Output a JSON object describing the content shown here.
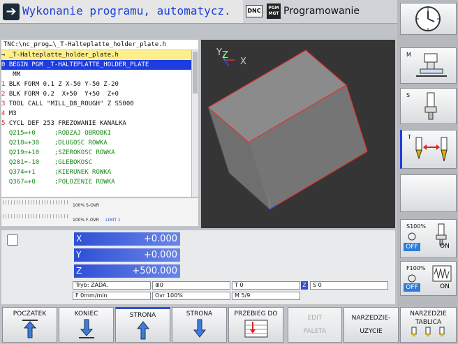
{
  "header": {
    "mode_icon": "arrow-right-icon",
    "mode_title": "Wykonanie programu, automatycz.",
    "dnc_badge": "DNC",
    "pgm_badge_line1": "PGM",
    "pgm_badge_line2": "MGT",
    "prog_title": "Programowanie"
  },
  "program": {
    "path": "TNC:\\nc_prog…\\_T-Halteplatte_holder_plate.h",
    "lines": [
      {
        "n": "",
        "t": "→ _T-Halteplatte_holder_plate.h",
        "style": "file"
      },
      {
        "n": "0",
        "t": "BEGIN PGM _T-HALTEPLATTE_HOLDER_PLATE",
        "style": "sel"
      },
      {
        "n": "",
        "t": "  MM",
        "style": "normal"
      },
      {
        "n": "1",
        "t": "BLK FORM 0.1 Z X-50 Y-50 Z-20",
        "style": "normal"
      },
      {
        "n": "2",
        "t": "BLK FORM 0.2  X+50  Y+50  Z+0",
        "style": "normal"
      },
      {
        "n": "3",
        "t": "TOOL CALL \"MILL_D8_ROUGH\" Z S5000",
        "style": "normal"
      },
      {
        "n": "4",
        "t": "M3",
        "style": "normal"
      },
      {
        "n": "5",
        "t": "CYCL DEF 253 FREZOWANIE KANALKA",
        "style": "normal"
      },
      {
        "n": "",
        "t": "  Q215=+0     ;RODZAJ OBROBKI",
        "style": "q"
      },
      {
        "n": "",
        "t": "  Q218=+30    ;DLUGOSC ROWKA",
        "style": "q"
      },
      {
        "n": "",
        "t": "  Q219=+10    ;SZEROKOSC ROWKA",
        "style": "q"
      },
      {
        "n": "",
        "t": "  Q201=-10    ;GLEBOKOSC",
        "style": "q"
      },
      {
        "n": "",
        "t": "  Q374=+1     ;KIERUNEK ROWKA",
        "style": "q"
      },
      {
        "n": "",
        "t": "  Q367=+0     ;POLOZENIE ROWKA",
        "style": "q"
      }
    ],
    "s_ovr": "100% S-OVR",
    "f_ovr": "100% F-OVR",
    "f_limit": "LIMIT 1"
  },
  "view3d": {
    "axes": [
      "Y",
      "Z",
      "X"
    ]
  },
  "positions": {
    "x_label": "X",
    "x_value": "+0.000",
    "y_label": "Y",
    "y_value": "+0.000",
    "z_label": "Z",
    "z_value": "+500.000"
  },
  "status": {
    "tryb": "Tryb: ZADA.",
    "kin_value": "0",
    "tool": "T 0",
    "axis": "Z",
    "spindle": "S 0",
    "feed": "F 0mm/min",
    "ovr": "Ovr 100%",
    "m_func": "M 5/9"
  },
  "right_softkeys": {
    "m_label": "M",
    "s_label": "S",
    "t_label": "T",
    "s100_label": "S100%",
    "s100_off": "OFF",
    "s100_on": "ON",
    "f100_label": "F100%",
    "f100_off": "OFF",
    "f100_on": "ON"
  },
  "bottom_softkeys": {
    "k1": "POCZATEK",
    "k2": "KONIEC",
    "k3": "STRONA",
    "k4": "STRONA",
    "k5": "PRZEBIEG DO",
    "k6a": "EDIT",
    "k6b": "PALETA",
    "k7a": "NARZEDZIE-",
    "k7b": "UZYCIE",
    "k8a": "NARZEDZIE",
    "k8b": "TABLICA"
  },
  "colors": {
    "selection": "#1e3de0",
    "q_param": "#1a8a1a",
    "line_number": "#d42020",
    "axis_bar": "#2e4fd6"
  }
}
